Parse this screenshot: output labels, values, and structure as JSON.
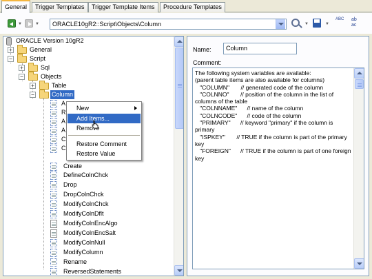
{
  "tabs": [
    "General",
    "Trigger Templates",
    "Trigger Template Items",
    "Procedure Templates"
  ],
  "toolbar": {
    "path": "ORACLE10gR2::Script\\Objects\\Column",
    "spell_label": "ABC",
    "abc_label": "ab\nac"
  },
  "tree": {
    "root": "ORACLE Version 10gR2",
    "general": "General",
    "script": "Script",
    "sql": "Sql",
    "objects": "Objects",
    "table": "Table",
    "column": "Column",
    "hidden_items": [
      "A",
      "R",
      "A",
      "A",
      "C",
      "C"
    ],
    "items": [
      "Create",
      "DefineColnChck",
      "Drop",
      "DropColnChck",
      "ModifyColnChck",
      "ModifyColnDflt",
      "ModifyColnEncAlgo",
      "ModifyColnEncSalt",
      "ModifyColnNull",
      "ModifyColumn",
      "Rename",
      "ReversedStatements"
    ]
  },
  "context_menu": {
    "items": [
      "New",
      "Add Items...",
      "Remove",
      "Restore Comment",
      "Restore Value"
    ]
  },
  "detail": {
    "name_label": "Name:",
    "name_value": "Column",
    "comment_label": "Comment:",
    "comment_text": "The following system variables are available:\n(parent table items are also available for columns)\n   \"COLUMN\"       // generated code of the column\n   \"COLNNO\"       // position of the column in the list of columns of the table\n   \"COLNNAME\"      // name of the column\n   \"COLNCODE\"      // code of the column\n   \"PRIMARY\"      // keyword \"primary\" if the column is primary\n   \"ISPKEY\"       // TRUE if the column is part of the primary key\n   \"FOREIGN\"      // TRUE if the column is part of one foreign key"
  }
}
